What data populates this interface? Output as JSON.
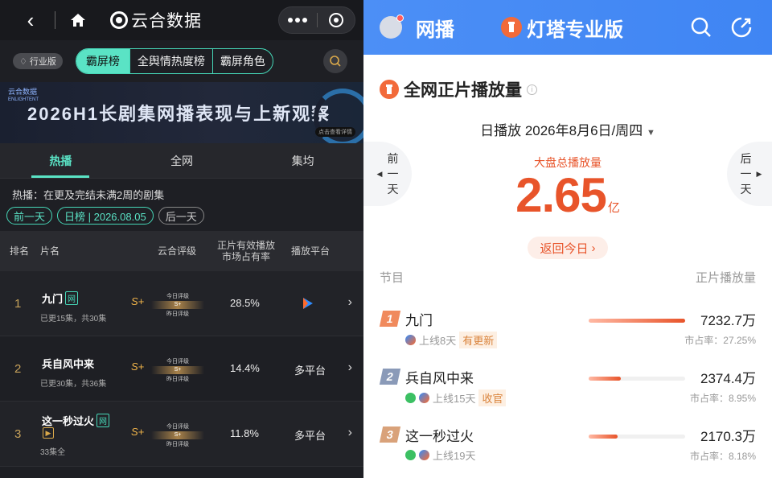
{
  "left": {
    "brand": "云合数据",
    "industry_badge": "行业版",
    "segments": [
      "霸屏榜",
      "全舆情热度榜",
      "霸屏角色"
    ],
    "banner_title": "2026H1长剧集网播表现与上新观察",
    "banner_logo": "云合数据",
    "banner_logo_sub": "ENLIGHTENT",
    "banner_button": "点击查看详情",
    "tabs": [
      "热播",
      "全网",
      "集均"
    ],
    "hint": "热播：在更及完结未满2周的剧集",
    "date_prev": "前一天",
    "date_current": "日榜 | 2026.08.05",
    "date_next": "后一天",
    "headers": {
      "rank": "排名",
      "name": "片名",
      "rating": "云合评级",
      "share": "正片有效播放\n市场占有率",
      "platform": "播放平台"
    },
    "rating_labels": {
      "today": "今日评级",
      "yesterday": "昨日评级"
    },
    "rows": [
      {
        "rank": "1",
        "name": "九门",
        "tag": "网",
        "sub": "已更15集，共30集",
        "rating": "S+",
        "rb": "S+",
        "share": "28.5%",
        "platform": ""
      },
      {
        "rank": "2",
        "name": "兵自风中来",
        "tag": "",
        "sub": "已更30集，共36集",
        "rating": "S+",
        "rb": "S+",
        "share": "14.4%",
        "platform": "多平台"
      },
      {
        "rank": "3",
        "name": "这一秒过火",
        "tag": "网",
        "sub": "33集全",
        "rating": "S+",
        "rb": "S+",
        "share": "11.8%",
        "platform": "多平台"
      }
    ]
  },
  "right": {
    "wangbo": "网播",
    "lighthouse": "灯塔专业版",
    "section_title": "全网正片播放量",
    "date": "日播放  2026年8月6日/周四",
    "prev_day": "前\n一\n天",
    "next_day": "后\n一\n天",
    "total_label": "大盘总播放量",
    "total_value": "2.65",
    "total_unit": "亿",
    "back_today": "返回今日",
    "col_program": "节目",
    "col_views": "正片播放量",
    "items": [
      {
        "rank": "1",
        "title": "九门",
        "days": "上线8天",
        "tag": "有更新",
        "value": "7232.7万",
        "share": "市占率：27.25%",
        "ratio": 1.0,
        "badge_color": "#f08a5d"
      },
      {
        "rank": "2",
        "title": "兵自风中来",
        "days": "上线15天",
        "tag": "收官",
        "value": "2374.4万",
        "share": "市占率：8.95%",
        "ratio": 0.33,
        "badge_color": "#8a9ab8"
      },
      {
        "rank": "3",
        "title": "这一秒过火",
        "days": "上线19天",
        "tag": "",
        "value": "2170.3万",
        "share": "市占率：8.18%",
        "ratio": 0.3,
        "badge_color": "#d9a27a"
      }
    ]
  }
}
